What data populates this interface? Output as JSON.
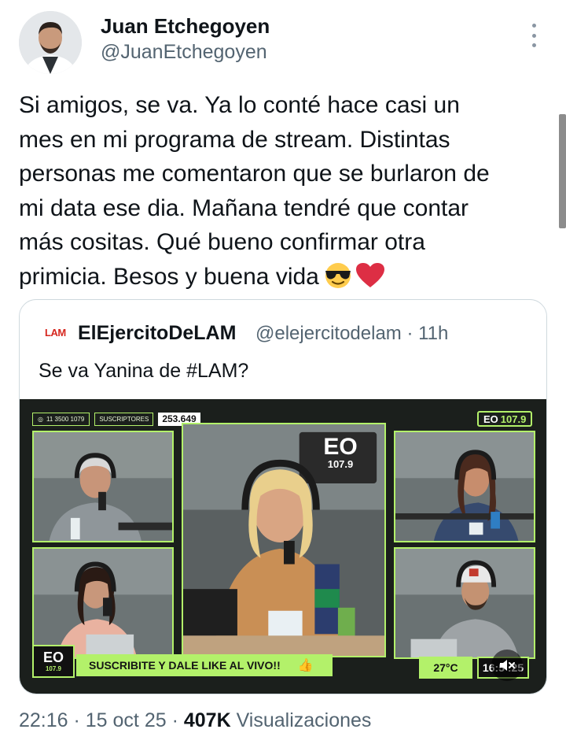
{
  "author": {
    "name": "Juan Etchegoyen",
    "handle": "@JuanEtchegoyen"
  },
  "tweet": {
    "text": "Si amigos, se va. Ya lo conté hace casi un\nmes en mi programa de stream. Distintas\npersonas me comentaron que se burlaron de\nmi data ese dia. Mañana tendré que contar\nmás cositas. Qué bueno confirmar otra\nprimicia. Besos y buena vida",
    "emojis": [
      "smiling-face-with-sunglasses",
      "red-heart"
    ]
  },
  "quote": {
    "logo": "LAM",
    "name": "ElEjercitoDeLAM",
    "handle_time": "@elejercitodelam · 11h",
    "text": "Se va Yanina de #LAM?"
  },
  "video": {
    "phone": "11 3500 1079",
    "subs_label": "SUSCRIPTORES",
    "subs_count": "253.649",
    "station_small": "EO",
    "station_freq": "107.9",
    "wall_logo_top": "EO",
    "wall_logo_bottom": "107.9",
    "banner": "SUSCRIBITE Y DALE LIKE AL VIVO!!",
    "temperature": "27°C",
    "clock": "16:5 :25",
    "bottom_logo_eo": "EO",
    "bottom_logo_freq": "107.9",
    "accent": "#b3f16a"
  },
  "meta": {
    "time_date": "22:16 · 15 oct 25 · ",
    "views_count": "407K",
    "views_label": " Visualizaciones"
  }
}
